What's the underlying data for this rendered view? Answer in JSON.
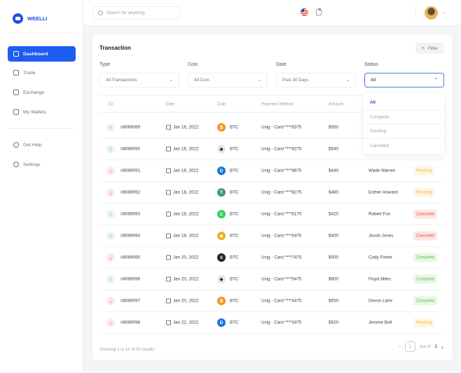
{
  "brand": {
    "name": "WEELLI",
    "color": "#1f4fe0"
  },
  "sidebar": {
    "items": [
      {
        "label": "Dashboard",
        "icon": "home-icon",
        "active": true
      },
      {
        "label": "Trade",
        "icon": "chart-icon"
      },
      {
        "label": "Exchange",
        "icon": "exchange-icon"
      },
      {
        "label": "My Wallets",
        "icon": "wallet-icon"
      }
    ],
    "bottom": [
      {
        "label": "Get Help",
        "icon": "help-icon"
      },
      {
        "label": "Settings",
        "icon": "gear-icon"
      }
    ]
  },
  "topbar": {
    "search_placeholder": "Search for anything"
  },
  "card": {
    "title": "Transaction",
    "filter_label": "Filter"
  },
  "filters": [
    {
      "label": "Type",
      "value": "All Transactions"
    },
    {
      "label": "Coin",
      "value": "All Coin"
    },
    {
      "label": "Date",
      "value": "Past 30 Days"
    },
    {
      "label": "Status",
      "value": "All"
    }
  ],
  "status_options": [
    "All",
    "Complete",
    "Pending",
    "Canceled"
  ],
  "columns": [
    "ID",
    "Date",
    "Coin",
    "Payment Method",
    "Amount"
  ],
  "rows": [
    {
      "dir": "up",
      "id": "#8089089",
      "date": "Jan 16, 2022",
      "coin": "BTC",
      "coin_color": "#f7931a",
      "coin_glyph": "₿",
      "method": "Usig - Card ****8375",
      "amount": "$550",
      "name": "",
      "status": ""
    },
    {
      "dir": "up",
      "id": "#8089090",
      "date": "Jan 16, 2022",
      "coin": "BTC",
      "coin_color": "#e5e7eb",
      "coin_glyph": "◆",
      "method": "Usig - Card ****8275",
      "amount": "$540",
      "name": "",
      "status": ""
    },
    {
      "dir": "down",
      "id": "#8089091",
      "date": "Jan 16, 2022",
      "coin": "BTC",
      "coin_color": "#1c75d8",
      "coin_glyph": "D",
      "method": "Usig - Card ****8675",
      "amount": "$440",
      "name": "Wade Warren",
      "status": "Pending"
    },
    {
      "dir": "down",
      "id": "#8089092",
      "date": "Jan 18, 2022",
      "coin": "BTC",
      "coin_color": "#3f9d7a",
      "coin_glyph": "T",
      "method": "Usig - Card ****8275",
      "amount": "$480",
      "name": "Esther Howard",
      "status": "Pending"
    },
    {
      "dir": "up",
      "id": "#8089093",
      "date": "Jan 18, 2022",
      "coin": "BTC",
      "coin_color": "#2fd35b",
      "coin_glyph": "C",
      "method": "Usig - Card ****8175",
      "amount": "$420",
      "name": "Robert Fox",
      "status": "Canceled"
    },
    {
      "dir": "up",
      "id": "#8089094",
      "date": "Jan 18, 2022",
      "coin": "BTC",
      "coin_color": "#e8b21c",
      "coin_glyph": "◈",
      "method": "Usig - Card ****6475",
      "amount": "$400",
      "name": "Jacob Jones",
      "status": "Canceled"
    },
    {
      "dir": "down",
      "id": "#8089095",
      "date": "Jan 20, 2022",
      "coin": "BTC",
      "coin_color": "#1f2328",
      "coin_glyph": "S",
      "method": "Usig - Card ****7475",
      "amount": "$500",
      "name": "Cody Fisher",
      "status": "Complete"
    },
    {
      "dir": "up",
      "id": "#8089096",
      "date": "Jan 20, 2022",
      "coin": "BTC",
      "coin_color": "#e5e7eb",
      "coin_glyph": "◆",
      "method": "Usig - Card ****5475",
      "amount": "$600",
      "name": "Floyd Miles",
      "status": "Complete"
    },
    {
      "dir": "down",
      "id": "#8089097",
      "date": "Jan 20, 2022",
      "coin": "BTC",
      "coin_color": "#f7931a",
      "coin_glyph": "₿",
      "method": "Usig - Card ****4475",
      "amount": "$650",
      "name": "Devon Lane",
      "status": "Complete"
    },
    {
      "dir": "down",
      "id": "#8089098",
      "date": "Jan 22, 2022",
      "coin": "BTC",
      "coin_color": "#1c75d8",
      "coin_glyph": "D",
      "method": "Usig - Card ****3475",
      "amount": "$620",
      "name": "Jerome Bell",
      "status": "Pending"
    }
  ],
  "footer": {
    "summary": "Showing 1 to 10 of 50 results",
    "page": "1",
    "out_of": "out of",
    "total_pages": "5"
  }
}
